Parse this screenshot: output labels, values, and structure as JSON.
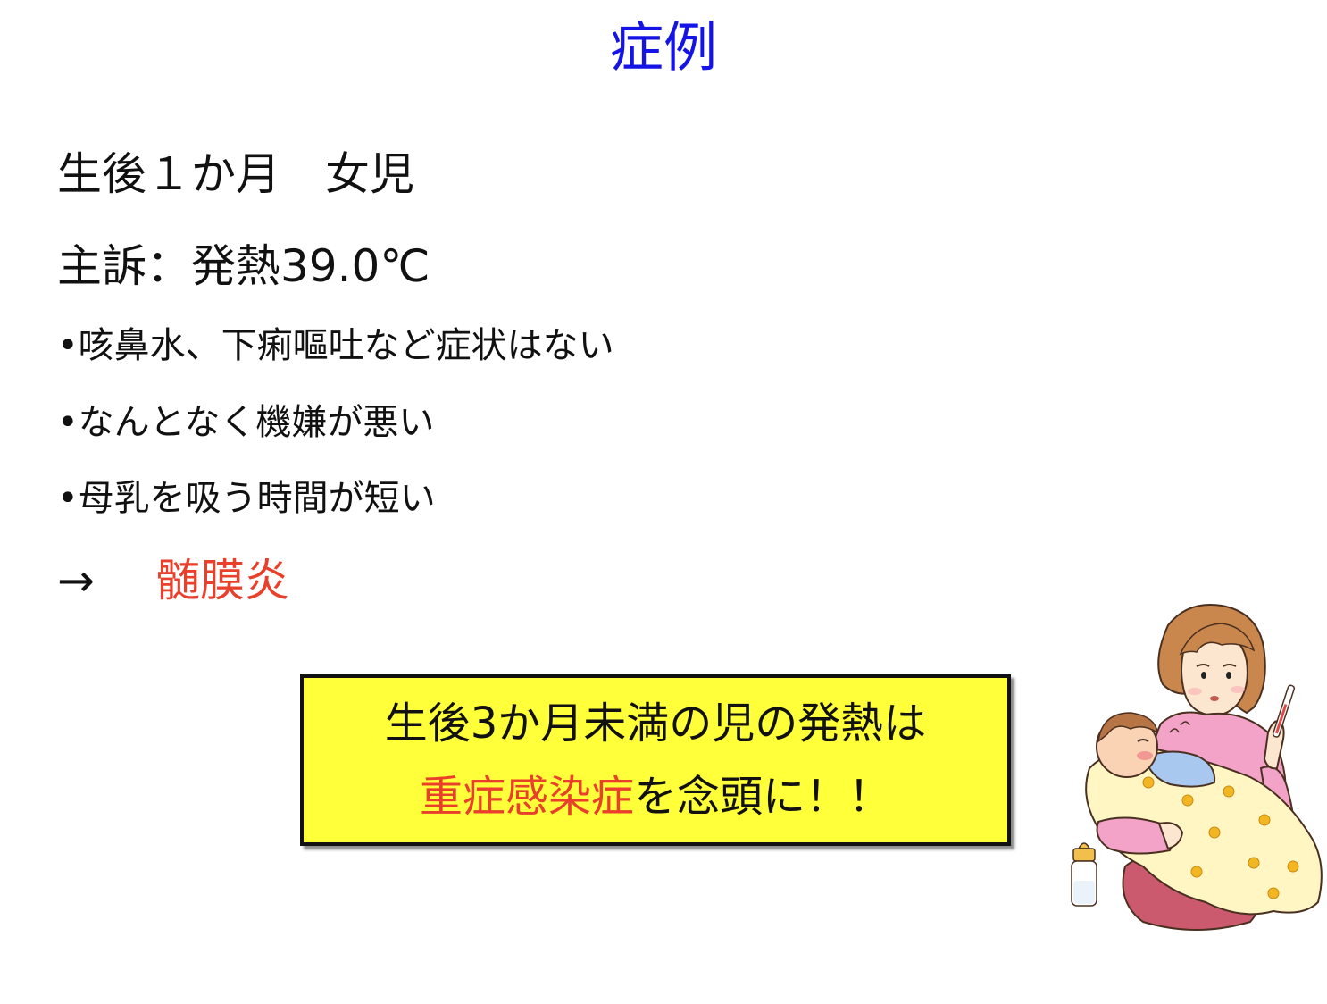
{
  "title": "症例",
  "patient": "生後１か月　女児",
  "complaint": "主訴：発熱39.0℃",
  "bullets": [
    "•咳鼻水、下痢嘔吐など症状はない",
    "•なんとなく機嫌が悪い",
    "•母乳を吸う時間が短い"
  ],
  "conclusion": {
    "arrow": "→",
    "diagnosis": "髄膜炎"
  },
  "callout": {
    "line1": "生後3か月未満の児の発熱は",
    "line2_highlight": "重症感染症",
    "line2_rest": "を念頭に！！"
  },
  "colors": {
    "title": "#1414e6",
    "accent_red": "#e8402a",
    "callout_bg": "#ffff3a"
  },
  "illustration": {
    "subject": "mother-holding-sick-baby-with-thermometer",
    "icons": [
      "thermometer-icon",
      "baby-bottle-icon"
    ]
  }
}
